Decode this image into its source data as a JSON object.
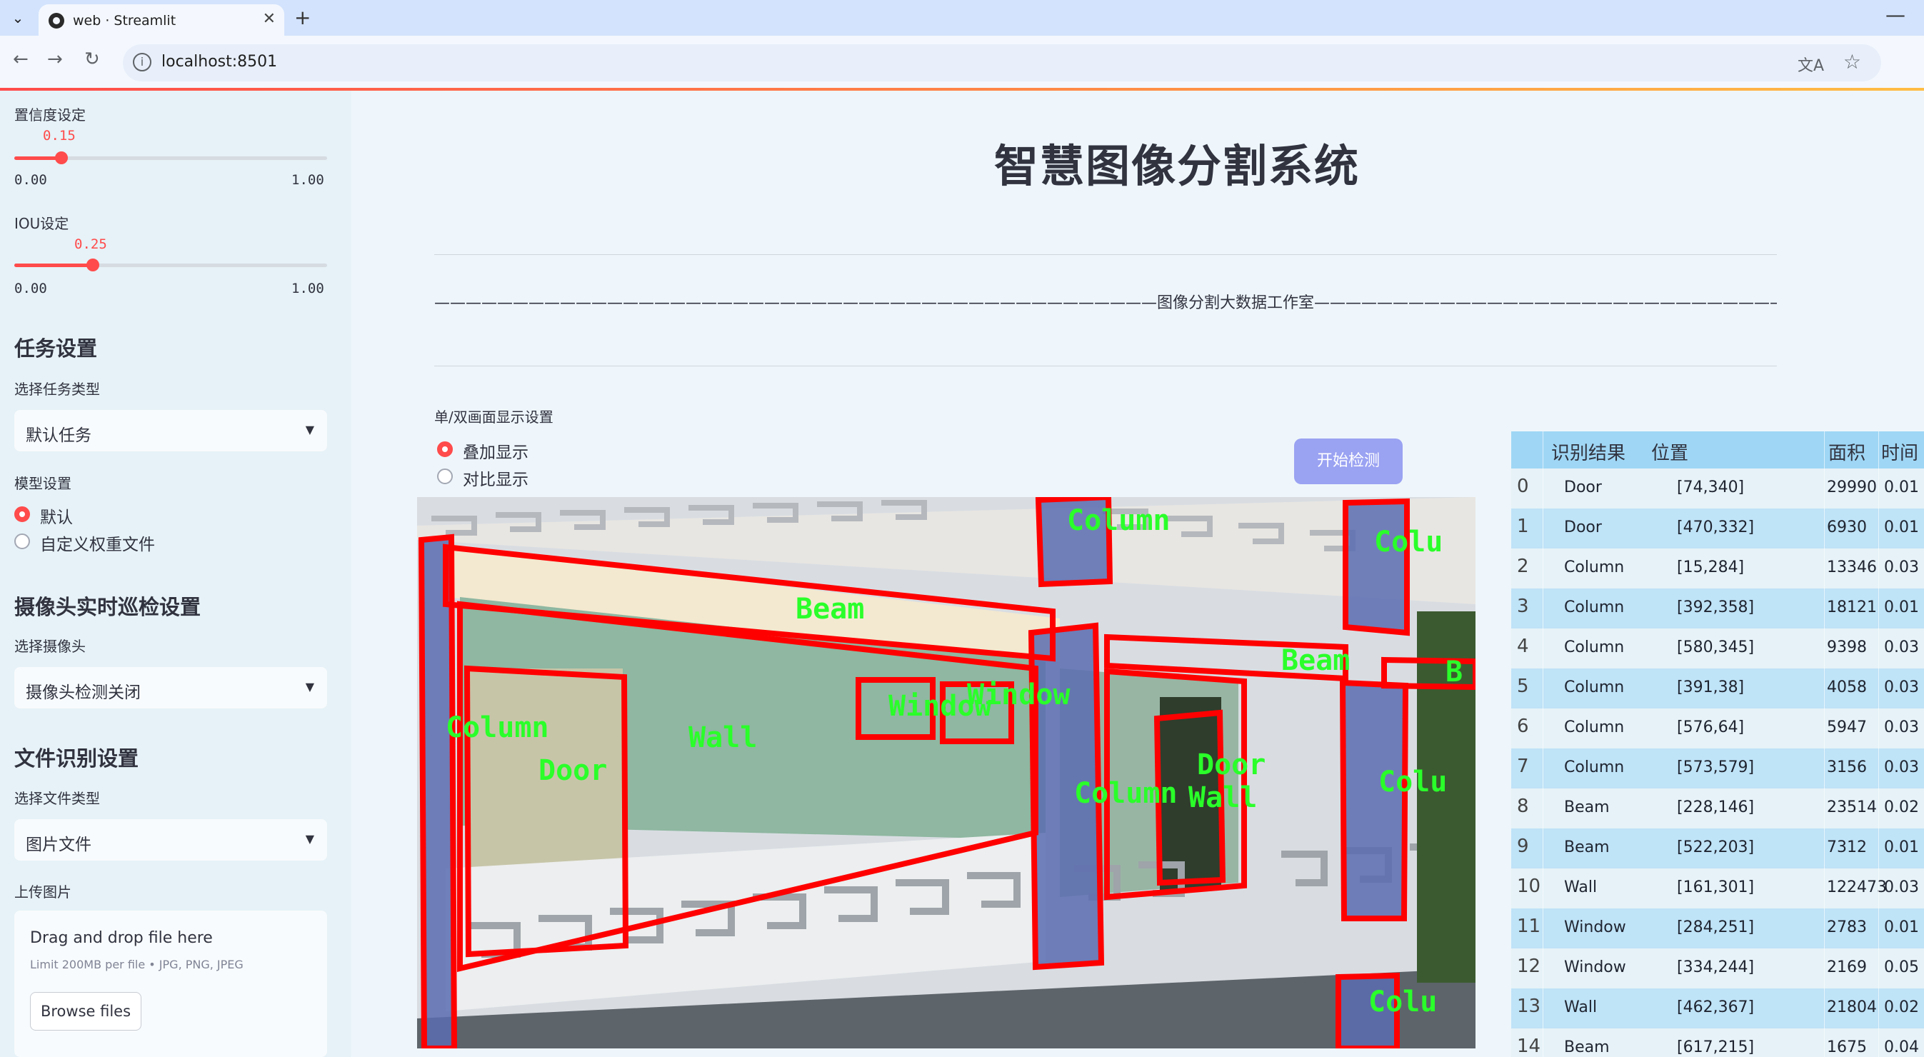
{
  "browser": {
    "tab_title": "web · Streamlit",
    "url": "localhost:8501",
    "icons": [
      "tab-dropdown-icon",
      "streamlit-favicon-icon",
      "close-icon",
      "new-tab-icon",
      "minimize-icon",
      "back-icon",
      "forward-icon",
      "reload-icon",
      "site-info-icon",
      "translate-icon",
      "bookmark-star-icon"
    ]
  },
  "sidebar": {
    "confidence": {
      "label": "置信度设定",
      "value": "0.15",
      "min": "0.00",
      "max": "1.00",
      "fraction": 0.15
    },
    "iou": {
      "label": "IOU设定",
      "value": "0.25",
      "min": "0.00",
      "max": "1.00",
      "fraction": 0.25
    },
    "task_heading": "任务设置",
    "task_type_label": "选择任务类型",
    "task_type_value": "默认任务",
    "model_label": "模型设置",
    "model_options": [
      "默认",
      "自定义权重文件"
    ],
    "model_selected": 0,
    "camera_heading": "摄像头实时巡检设置",
    "camera_label": "选择摄像头",
    "camera_value": "摄像头检测关闭",
    "file_heading": "文件识别设置",
    "file_type_label": "选择文件类型",
    "file_type_value": "图片文件",
    "upload_label": "上传图片",
    "upload_title": "Drag and drop file here",
    "upload_hint": "Limit 200MB per file • JPG, PNG, JPEG",
    "browse_label": "Browse files"
  },
  "main": {
    "title": "智慧图像分割系统",
    "studio": "——————————————————————————————————————————————图像分割大数据工作室——————————————————————————————————————————————",
    "display_label": "单/双画面显示设置",
    "display_options": [
      "叠加显示",
      "对比显示"
    ],
    "display_selected": 0,
    "start_button": "开始检测"
  },
  "detections_overlay": [
    "Column",
    "Colu",
    "Beam",
    "Beam",
    "B",
    "Window",
    "Window",
    "Column",
    "Wall",
    "Door",
    "Door",
    "Column",
    "Wall",
    "Colu",
    "Colu"
  ],
  "table": {
    "headers": [
      "识别结果",
      "位置",
      "面积",
      "时间"
    ],
    "rows": [
      {
        "idx": "0",
        "result": "Door",
        "pos": "[74,340]",
        "area": "29990",
        "time": "0.01"
      },
      {
        "idx": "1",
        "result": "Door",
        "pos": "[470,332]",
        "area": "6930",
        "time": "0.01"
      },
      {
        "idx": "2",
        "result": "Column",
        "pos": "[15,284]",
        "area": "13346",
        "time": "0.03"
      },
      {
        "idx": "3",
        "result": "Column",
        "pos": "[392,358]",
        "area": "18121",
        "time": "0.01"
      },
      {
        "idx": "4",
        "result": "Column",
        "pos": "[580,345]",
        "area": "9398",
        "time": "0.03"
      },
      {
        "idx": "5",
        "result": "Column",
        "pos": "[391,38]",
        "area": "4058",
        "time": "0.03"
      },
      {
        "idx": "6",
        "result": "Column",
        "pos": "[576,64]",
        "area": "5947",
        "time": "0.03"
      },
      {
        "idx": "7",
        "result": "Column",
        "pos": "[573,579]",
        "area": "3156",
        "time": "0.03"
      },
      {
        "idx": "8",
        "result": "Beam",
        "pos": "[228,146]",
        "area": "23514",
        "time": "0.02"
      },
      {
        "idx": "9",
        "result": "Beam",
        "pos": "[522,203]",
        "area": "7312",
        "time": "0.01"
      },
      {
        "idx": "10",
        "result": "Wall",
        "pos": "[161,301]",
        "area": "122473",
        "time": "0.03"
      },
      {
        "idx": "11",
        "result": "Window",
        "pos": "[284,251]",
        "area": "2783",
        "time": "0.01"
      },
      {
        "idx": "12",
        "result": "Window",
        "pos": "[334,244]",
        "area": "2169",
        "time": "0.05"
      },
      {
        "idx": "13",
        "result": "Wall",
        "pos": "[462,367]",
        "area": "21804",
        "time": "0.02"
      },
      {
        "idx": "14",
        "result": "Beam",
        "pos": "[617,215]",
        "area": "1675",
        "time": "0.04"
      }
    ]
  }
}
